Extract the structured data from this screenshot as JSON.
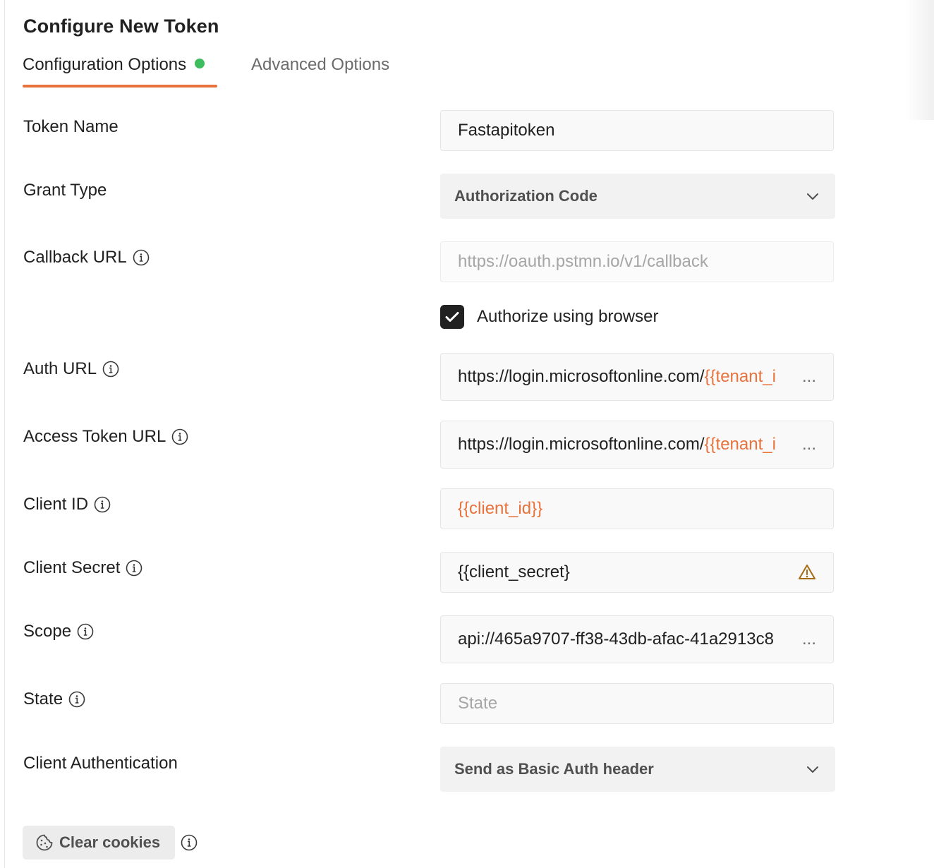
{
  "title": "Configure New Token",
  "tabs": [
    {
      "label": "Configuration Options",
      "active": true,
      "status": "green-dot"
    },
    {
      "label": "Advanced Options",
      "active": false
    }
  ],
  "colors": {
    "accent": "#e8723c",
    "status_dot": "#3dbd5d",
    "warning": "#a56a12"
  },
  "form": {
    "token_name": {
      "label": "Token Name",
      "value": "Fastapitoken"
    },
    "grant_type": {
      "label": "Grant Type",
      "value": "Authorization Code",
      "icon": "chevron-down-icon"
    },
    "callback_url": {
      "label": "Callback URL",
      "value": "https://oauth.pstmn.io/v1/callback",
      "icon": "info-icon"
    },
    "authorize_browser": {
      "label": "Authorize using browser",
      "checked": true
    },
    "auth_url": {
      "label": "Auth URL",
      "value_prefix": "https://login.microsoftonline.com/",
      "value_var": "{{tenant_i",
      "ellipsis": "...",
      "icon": "info-icon"
    },
    "access_token_url": {
      "label": "Access Token URL",
      "value_prefix": "https://login.microsoftonline.com/",
      "value_var": "{{tenant_i",
      "ellipsis": "...",
      "icon": "info-icon"
    },
    "client_id": {
      "label": "Client ID",
      "value": "{{client_id}}",
      "icon": "info-icon"
    },
    "client_secret": {
      "label": "Client Secret",
      "value": "{{client_secret}",
      "icon": "info-icon",
      "status_icon": "warning-icon"
    },
    "scope": {
      "label": "Scope",
      "value": "api://465a9707-ff38-43db-afac-41a2913c8",
      "ellipsis": "...",
      "icon": "info-icon"
    },
    "state": {
      "label": "State",
      "placeholder": "State",
      "icon": "info-icon"
    },
    "client_authentication": {
      "label": "Client Authentication",
      "value": "Send as Basic Auth header",
      "icon": "chevron-down-icon"
    }
  },
  "clear_cookies": {
    "label": "Clear cookies",
    "icon": "cookie-icon",
    "info_icon": "info-icon"
  }
}
